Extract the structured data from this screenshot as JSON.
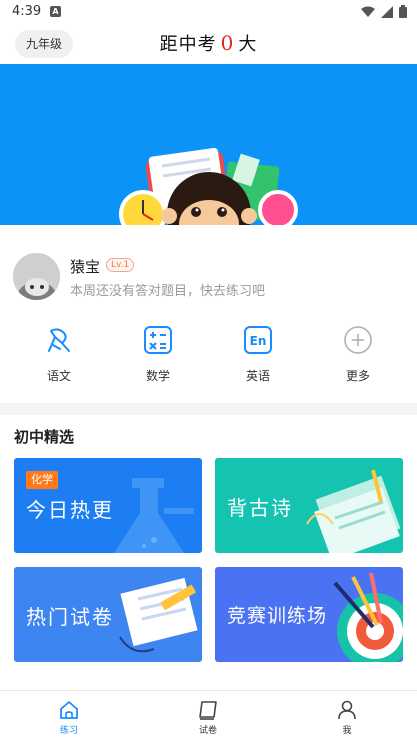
{
  "status_bar": {
    "time": "4:39",
    "notification_letter": "A"
  },
  "header": {
    "grade_label": "九年级",
    "countdown_prefix": "距中考",
    "countdown_days": "0",
    "countdown_suffix": "大"
  },
  "banner": {
    "background_color": "#0b93f7"
  },
  "profile": {
    "username": "猿宝",
    "level": "Lv.1",
    "subtitle": "本周还没有答对题目，快去练习吧"
  },
  "subjects": [
    {
      "label": "语文",
      "icon": "chinese-icon"
    },
    {
      "label": "数学",
      "icon": "math-icon"
    },
    {
      "label": "英语",
      "icon": "english-icon",
      "icon_text": "En"
    },
    {
      "label": "更多",
      "icon": "plus-icon"
    }
  ],
  "selection": {
    "title": "初中精选",
    "cards": [
      {
        "title": "今日热更",
        "tag": "化学",
        "color": "#1c7ef2"
      },
      {
        "title": "背古诗",
        "color": "#14c3b0"
      },
      {
        "title": "热门试卷",
        "color": "#3d85f0"
      },
      {
        "title": "竞赛训练场",
        "color": "#4a72f2"
      }
    ]
  },
  "bottom_nav": [
    {
      "label": "练习",
      "icon": "home-icon",
      "active": true
    },
    {
      "label": "试卷",
      "icon": "paper-icon",
      "active": false
    },
    {
      "label": "我",
      "icon": "user-icon",
      "active": false
    }
  ],
  "colors": {
    "accent": "#1a8cff",
    "countdown_number": "#e5261f",
    "icon_blue": "#1a8cff"
  }
}
